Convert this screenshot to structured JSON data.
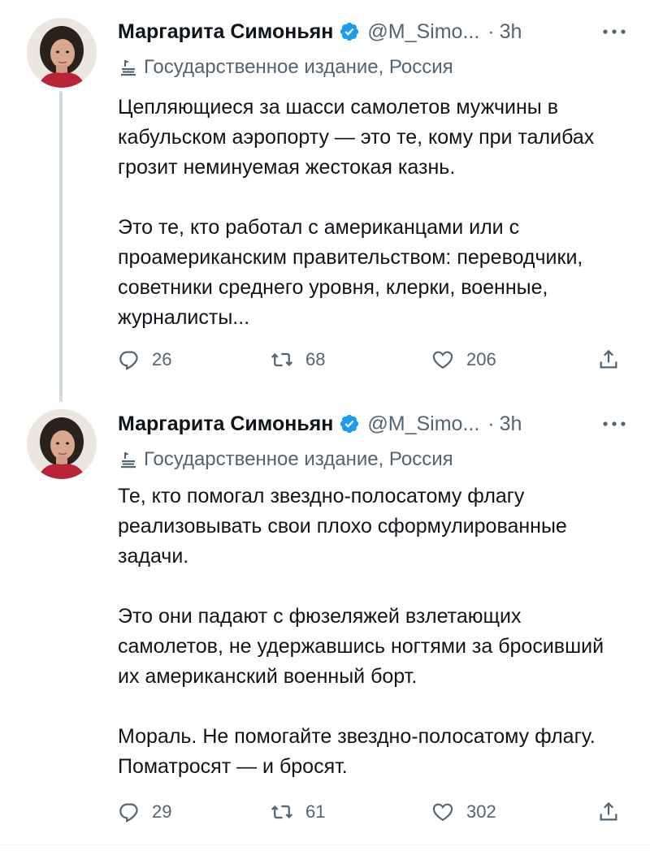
{
  "tweets": [
    {
      "author": {
        "name": "Маргарита Симоньян",
        "handle": "@M_Simo...",
        "verified": true
      },
      "separator": "·",
      "time": "3h",
      "label": "Государственное издание, Россия",
      "text": "Цепляющиеся за шасси самолетов мужчины в кабульском аэропорту — это те, кому при талибах грозит неминуемая жестокая казнь.\n\nЭто те, кто работал с американцами или с проамериканским правительством: переводчики, советники среднего уровня, клерки, военные, журналисты...",
      "stats": {
        "replies": "26",
        "retweets": "68",
        "likes": "206"
      }
    },
    {
      "author": {
        "name": "Маргарита Симоньян",
        "handle": "@M_Simo...",
        "verified": true
      },
      "separator": "·",
      "time": "3h",
      "label": "Государственное издание, Россия",
      "text": "Те, кто помогал звездно-полосатому флагу реализовывать свои плохо сформулированные задачи.\n\nЭто они падают с фюзеляжей взлетающих самолетов, не удержавшись ногтями за бросивший их американский военный борт.\n\nМораль. Не помогайте звездно-полосатому флагу. Поматросят — и бросят.",
      "stats": {
        "replies": "29",
        "retweets": "61",
        "likes": "302"
      }
    }
  ],
  "icons": {
    "verified": "verified-badge-icon",
    "label": "government-label-icon",
    "more": "more-horizontal-icon",
    "reply": "reply-icon",
    "retweet": "retweet-icon",
    "like": "like-heart-icon",
    "share": "share-icon"
  },
  "colors": {
    "text": "#0f1419",
    "secondary": "#536471",
    "verified": "#1d9bf0",
    "thread_line": "#cfd9de"
  }
}
